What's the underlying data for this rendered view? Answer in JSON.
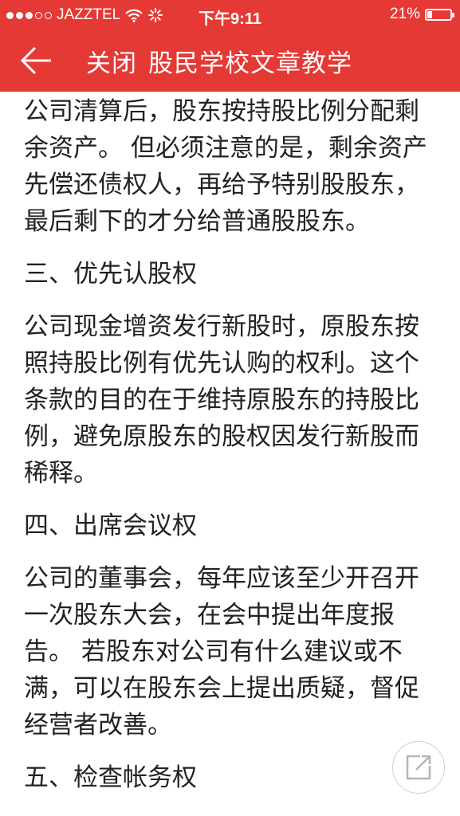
{
  "status": {
    "carrier": "JAZZTEL",
    "time": "下午9:11",
    "battery": "21%",
    "battery_level": 0.21,
    "signal_dots": 5,
    "signal_filled": 3
  },
  "nav": {
    "close_label": "关闭",
    "title": "股民学校文章教学"
  },
  "article": {
    "p1": "公司清算后，股东按持股比例分配剩余资产。 但必须注意的是，剩余资产先偿还债权人，再给予特别股股东，最后剩下的才分给普通股股东。",
    "h3": "三、优先认股权",
    "p3": "公司现金增资发行新股时，原股东按照持股比例有优先认购的权利。这个条款的目的在于维持原股东的持股比例，避免原股东的股权因发行新股而稀释。",
    "h4": "四、出席会议权",
    "p4": "公司的董事会，每年应该至少开召开一次股东大会，在会中提出年度报告。 若股东对公司有什么建议或不满，可以在股东会上提出质疑，督促经营者改善。",
    "h5": "五、检查帐务权"
  },
  "colors": {
    "brand": "#e53935",
    "text": "#222222",
    "background": "#ffffff"
  },
  "icons": {
    "back": "arrow-left-icon",
    "share": "share-icon",
    "wifi": "wifi-icon",
    "loading": "spinner-icon",
    "battery": "battery-icon"
  }
}
